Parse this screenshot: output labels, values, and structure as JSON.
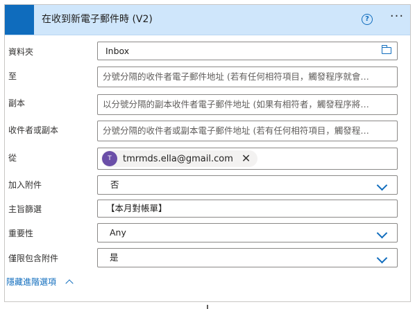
{
  "header": {
    "title": "在收到新電子郵件時 (V2)",
    "help_glyph": "?",
    "more_glyph": "···",
    "accent_color": "#0f6cbd",
    "background_color": "#cfe6fb"
  },
  "fields": {
    "folder": {
      "label": "資料夾",
      "value": "Inbox",
      "icon": "folder-icon"
    },
    "to": {
      "label": "至",
      "placeholder": "分號分隔的收件者電子郵件地址 (若有任何相符項目，觸發程序就會…"
    },
    "cc": {
      "label": "副本",
      "placeholder": "以分號分隔的副本收件者電子郵件地址 (如果有相符者，觸發程序將…"
    },
    "to_or_cc": {
      "label": "收件者或副本",
      "placeholder": "分號分隔的收件者或副本電子郵件地址 (若有任何相符項目，觸發程…"
    },
    "from": {
      "label": "從",
      "avatar_initial": "T",
      "avatar_color": "#6b4fa8",
      "email": "tmrmds.ella@gmail.com",
      "remove_glyph": "✕"
    },
    "include_attachments": {
      "label": "加入附件",
      "value": "否"
    },
    "subject_filter": {
      "label": "主旨篩選",
      "value": "【本月對帳單】"
    },
    "importance": {
      "label": "重要性",
      "value": "Any"
    },
    "only_with_attachments": {
      "label": "僅限包含附件",
      "value": "是"
    }
  },
  "footer": {
    "hide_advanced_label": "隱藏進階選項"
  }
}
